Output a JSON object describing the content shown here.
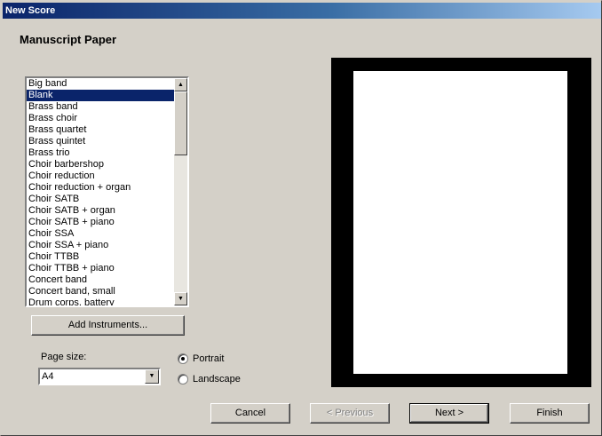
{
  "window": {
    "title": "New Score"
  },
  "heading": "Manuscript Paper",
  "paper_list": {
    "selected_index": 1,
    "items": [
      "Big band",
      "Blank",
      "Brass band",
      "Brass choir",
      "Brass quartet",
      "Brass quintet",
      "Brass trio",
      "Choir barbershop",
      "Choir reduction",
      "Choir reduction + organ",
      "Choir SATB",
      "Choir SATB + organ",
      "Choir SATB + piano",
      "Choir SSA",
      "Choir SSA + piano",
      "Choir TTBB",
      "Choir TTBB + piano",
      "Concert band",
      "Concert band, small",
      "Drum corps, battery"
    ]
  },
  "add_instruments_label": "Add Instruments...",
  "page_size": {
    "label": "Page size:",
    "value": "A4"
  },
  "orientation": {
    "portrait_label": "Portrait",
    "landscape_label": "Landscape",
    "selected": "Portrait"
  },
  "buttons": {
    "cancel": "Cancel",
    "previous": "< Previous",
    "next": "Next >",
    "finish": "Finish"
  },
  "icons": {
    "scroll_up": "up-arrow-icon",
    "scroll_down": "down-arrow-icon",
    "dropdown": "chevron-down-icon"
  }
}
